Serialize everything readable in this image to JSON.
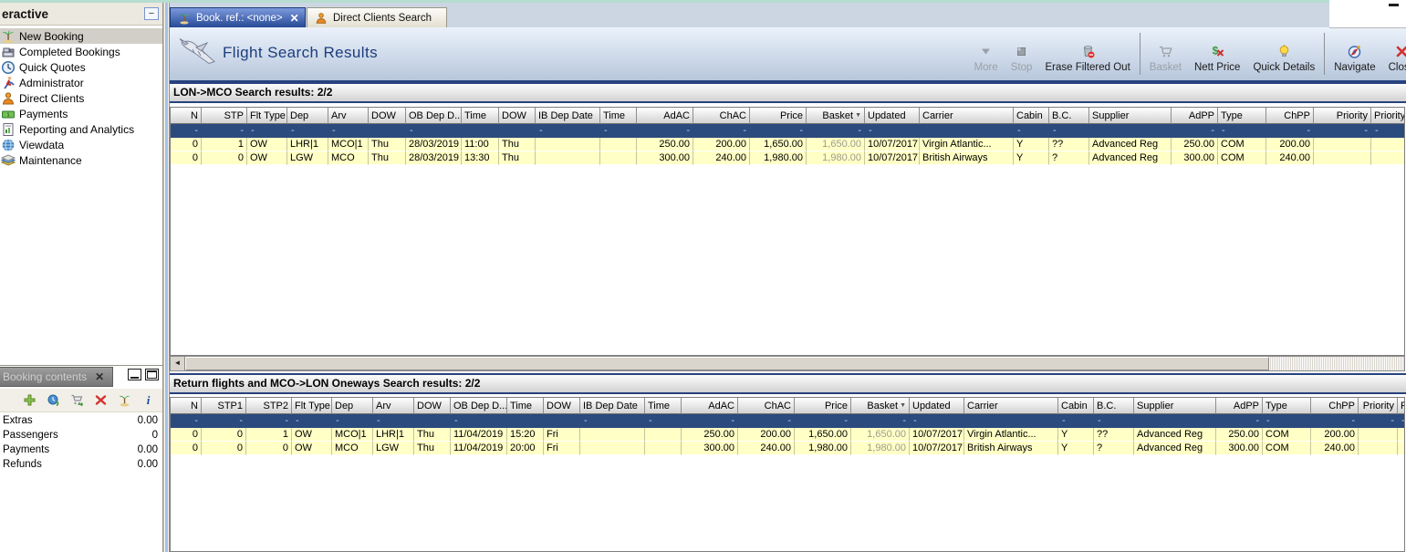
{
  "colors": {
    "accent_navy": "#27427e",
    "active_tab_blue": "#274a95",
    "row_yellow": "#ffffc6",
    "filter_row_navy": "#2b4a7e",
    "teal_strip": "#b7dcd0"
  },
  "glyphs": {
    "scroll_left": "◄",
    "sort_desc": "▼",
    "collapse": "−",
    "tab_close": "✕",
    "panel_close": "✕"
  },
  "sidebar": {
    "title": "eractive",
    "items": [
      {
        "label": "New Booking",
        "icon": "palm-tree-icon",
        "selected": true
      },
      {
        "label": "Completed Bookings",
        "icon": "register-icon",
        "selected": false
      },
      {
        "label": "Quick Quotes",
        "icon": "clock-icon",
        "selected": false
      },
      {
        "label": "Administrator",
        "icon": "runner-icon",
        "selected": false
      },
      {
        "label": "Direct Clients",
        "icon": "client-icon",
        "selected": false
      },
      {
        "label": "Payments",
        "icon": "money-icon",
        "selected": false
      },
      {
        "label": "Reporting and Analytics",
        "icon": "report-icon",
        "selected": false
      },
      {
        "label": "Viewdata",
        "icon": "globe-icon",
        "selected": false
      },
      {
        "label": "Maintenance",
        "icon": "books-icon",
        "selected": false
      }
    ]
  },
  "tabs": [
    {
      "label": "Book. ref.: <none>",
      "icon": "palm-tree-icon",
      "active": true,
      "closable": true
    },
    {
      "label": "Direct Clients Search",
      "icon": "client-icon",
      "active": false,
      "closable": false
    }
  ],
  "banner": {
    "title": "Flight Search Results",
    "icon": "airplane-icon"
  },
  "toolbar": {
    "buttons": [
      {
        "label": "More",
        "icon": "more-down-arrow-icon",
        "disabled": true
      },
      {
        "label": "Stop",
        "icon": "stop-icon",
        "disabled": true
      },
      {
        "label": "Erase Filtered Out",
        "icon": "erase-bin-icon",
        "disabled": false
      },
      {
        "label": "Basket",
        "icon": "basket-cart-icon",
        "disabled": true
      },
      {
        "label": "Nett Price",
        "icon": "nett-price-icon",
        "disabled": false
      },
      {
        "label": "Quick Details",
        "icon": "bulb-icon",
        "disabled": false
      },
      {
        "label": "Navigate",
        "icon": "compass-icon",
        "disabled": false
      },
      {
        "label": "Close",
        "icon": "close-red-x-icon",
        "disabled": false
      }
    ]
  },
  "results_top": {
    "title": "LON->MCO Search results: 2/2",
    "columns": [
      {
        "label": "N",
        "align": "right"
      },
      {
        "label": "STP",
        "align": "right"
      },
      {
        "label": "Flt Type",
        "align": "left"
      },
      {
        "label": "Dep",
        "align": "left"
      },
      {
        "label": "Arv",
        "align": "left"
      },
      {
        "label": "DOW",
        "align": "left"
      },
      {
        "label": "OB Dep D...",
        "align": "left"
      },
      {
        "label": "Time",
        "align": "left"
      },
      {
        "label": "DOW",
        "align": "left"
      },
      {
        "label": "IB Dep Date",
        "align": "left"
      },
      {
        "label": "Time",
        "align": "left"
      },
      {
        "label": "AdAC",
        "align": "right"
      },
      {
        "label": "ChAC",
        "align": "right"
      },
      {
        "label": "Price",
        "align": "right"
      },
      {
        "label": "Basket",
        "align": "right",
        "sort": "desc"
      },
      {
        "label": "Updated",
        "align": "left"
      },
      {
        "label": "Carrier",
        "align": "left"
      },
      {
        "label": "Cabin",
        "align": "left"
      },
      {
        "label": "B.C.",
        "align": "left"
      },
      {
        "label": "Supplier",
        "align": "left"
      },
      {
        "label": "AdPP",
        "align": "right"
      },
      {
        "label": "Type",
        "align": "left"
      },
      {
        "label": "ChPP",
        "align": "right"
      },
      {
        "label": "Priority",
        "align": "right"
      },
      {
        "label": "Priority de...",
        "align": "left"
      }
    ],
    "filter_row": [
      "-",
      "-",
      "-",
      "-",
      "-",
      "",
      "-",
      "",
      "",
      "-",
      "-",
      "-",
      "-",
      "-",
      "-",
      "-",
      "",
      "-",
      "-",
      "",
      "-",
      "-",
      "-",
      "-",
      "-"
    ],
    "rows": [
      [
        "0",
        "1",
        "OW",
        "LHR|1",
        "MCO|1",
        "Thu",
        "28/03/2019",
        "11:00",
        "Thu",
        "",
        "",
        "250.00",
        "200.00",
        "1,650.00",
        "1,650.00",
        "10/07/2017",
        "Virgin Atlantic...",
        "Y",
        "??",
        "Advanced Reg",
        "250.00",
        "COM",
        "200.00",
        "",
        ""
      ],
      [
        "0",
        "0",
        "OW",
        "LGW",
        "MCO",
        "Thu",
        "28/03/2019",
        "13:30",
        "Thu",
        "",
        "",
        "300.00",
        "240.00",
        "1,980.00",
        "1,980.00",
        "10/07/2017",
        "British Airways",
        "Y",
        "?",
        "Advanced Reg",
        "300.00",
        "COM",
        "240.00",
        "",
        ""
      ]
    ]
  },
  "results_bottom": {
    "title": "Return flights and MCO->LON Oneways Search results: 2/2",
    "columns": [
      {
        "label": "N",
        "align": "right"
      },
      {
        "label": "STP1",
        "align": "right"
      },
      {
        "label": "STP2",
        "align": "right"
      },
      {
        "label": "Flt Type",
        "align": "left"
      },
      {
        "label": "Dep",
        "align": "left"
      },
      {
        "label": "Arv",
        "align": "left"
      },
      {
        "label": "DOW",
        "align": "left"
      },
      {
        "label": "OB Dep D...",
        "align": "left"
      },
      {
        "label": "Time",
        "align": "left"
      },
      {
        "label": "DOW",
        "align": "left"
      },
      {
        "label": "IB Dep Date",
        "align": "left"
      },
      {
        "label": "Time",
        "align": "left"
      },
      {
        "label": "AdAC",
        "align": "right"
      },
      {
        "label": "ChAC",
        "align": "right"
      },
      {
        "label": "Price",
        "align": "right"
      },
      {
        "label": "Basket",
        "align": "right",
        "sort": "desc"
      },
      {
        "label": "Updated",
        "align": "left"
      },
      {
        "label": "Carrier",
        "align": "left"
      },
      {
        "label": "Cabin",
        "align": "left"
      },
      {
        "label": "B.C.",
        "align": "left"
      },
      {
        "label": "Supplier",
        "align": "left"
      },
      {
        "label": "AdPP",
        "align": "right"
      },
      {
        "label": "Type",
        "align": "left"
      },
      {
        "label": "ChPP",
        "align": "right"
      },
      {
        "label": "Priority",
        "align": "right"
      },
      {
        "label": "P",
        "align": "left"
      }
    ],
    "filter_row": [
      "-",
      "-",
      "-",
      "-",
      "-",
      "-",
      "",
      "-",
      "",
      "",
      "-",
      "-",
      "-",
      "-",
      "-",
      "-",
      "-",
      "",
      "-",
      "-",
      "",
      "-",
      "-",
      "-",
      "-",
      "-"
    ],
    "rows": [
      [
        "0",
        "0",
        "1",
        "OW",
        "MCO|1",
        "LHR|1",
        "Thu",
        "11/04/2019",
        "15:20",
        "Fri",
        "",
        "",
        "250.00",
        "200.00",
        "1,650.00",
        "1,650.00",
        "10/07/2017",
        "Virgin Atlantic...",
        "Y",
        "??",
        "Advanced Reg",
        "250.00",
        "COM",
        "200.00",
        "",
        ""
      ],
      [
        "0",
        "0",
        "0",
        "OW",
        "MCO",
        "LGW",
        "Thu",
        "11/04/2019",
        "20:00",
        "Fri",
        "",
        "",
        "300.00",
        "240.00",
        "1,980.00",
        "1,980.00",
        "10/07/2017",
        "British Airways",
        "Y",
        "?",
        "Advanced Reg",
        "300.00",
        "COM",
        "240.00",
        "",
        ""
      ]
    ]
  },
  "booking_contents": {
    "tab_label": "Booking contents",
    "toolbar_icons": [
      "add-icon",
      "world-clock-icon",
      "cart-checkout-icon",
      "delete-icon",
      "palm-tree-icon",
      "info-icon"
    ],
    "rows": [
      {
        "label": "Extras",
        "value": "0.00"
      },
      {
        "label": "Passengers",
        "value": "0"
      },
      {
        "label": "Payments",
        "value": "0.00"
      },
      {
        "label": "Refunds",
        "value": "0.00"
      }
    ]
  }
}
